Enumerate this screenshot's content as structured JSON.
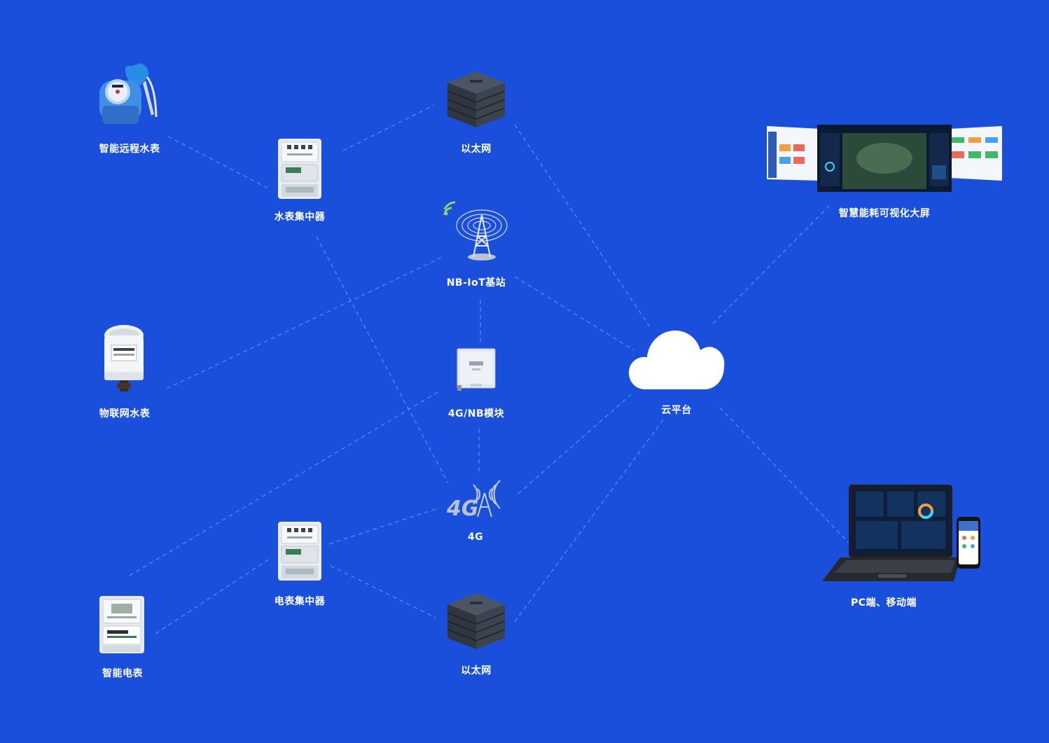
{
  "colors": {
    "background": "#1a4fdc",
    "link": "#45a8ff",
    "label": "#ffffff"
  },
  "nodes": {
    "smart_remote_water_meter": {
      "label": "智能远程水表",
      "icon": "water-meter-valve-icon"
    },
    "water_concentrator": {
      "label": "水表集中器",
      "icon": "concentrator-icon"
    },
    "ethernet_top": {
      "label": "以太网",
      "icon": "server-rack-icon"
    },
    "nb_iot_station": {
      "label": "NB-IoT基站",
      "icon": "signal-tower-icon"
    },
    "iot_water_meter": {
      "label": "物联网水表",
      "icon": "iot-water-meter-icon"
    },
    "module_4g_nb": {
      "label": "4G/NB模块",
      "icon": "communication-module-icon"
    },
    "cloud_platform": {
      "label": "云平台",
      "icon": "cloud-icon"
    },
    "visual_screen": {
      "label": "智慧能耗可视化大屏",
      "icon": "dashboard-screens-icon"
    },
    "net_4g": {
      "label": "4G",
      "icon": "4g-tower-icon"
    },
    "power_concentrator": {
      "label": "电表集中器",
      "icon": "concentrator-icon"
    },
    "smart_power_meter": {
      "label": "智能电表",
      "icon": "power-meter-icon"
    },
    "ethernet_bottom": {
      "label": "以太网",
      "icon": "server-rack-icon"
    },
    "pc_mobile": {
      "label": "PC端、移动端",
      "icon": "laptop-phone-icon"
    }
  }
}
